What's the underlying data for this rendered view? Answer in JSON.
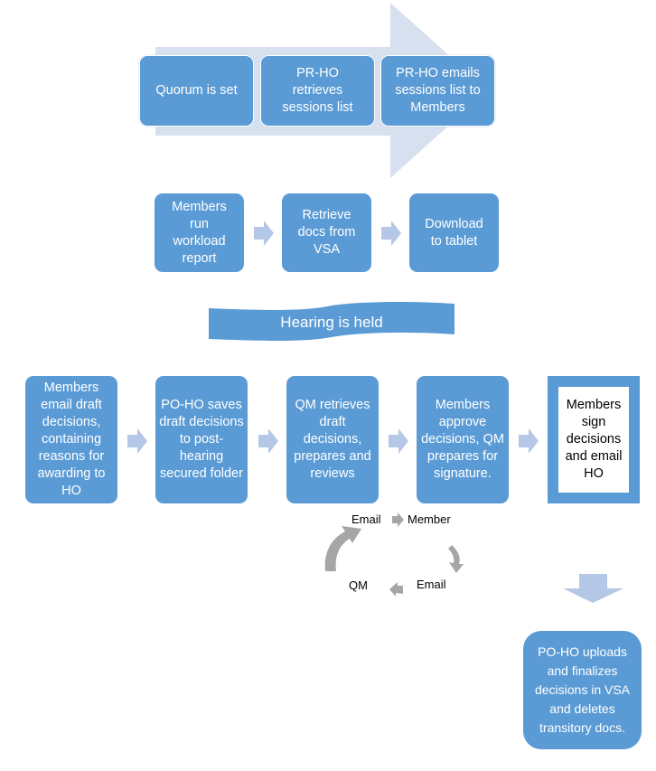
{
  "colors": {
    "box_fill": "#5b9bd5",
    "arrow_fill": "#b4c7e7",
    "big_arrow_fill": "#d6e0ee",
    "cycle_arrow_fill": "#a6a6a6"
  },
  "stage1": {
    "steps": [
      {
        "label": "Quorum is set"
      },
      {
        "label": "PR-HO retrieves sessions list"
      },
      {
        "label": "PR-HO emails sessions list to Members"
      }
    ]
  },
  "stage2": {
    "steps": [
      {
        "label": "Members run workload report"
      },
      {
        "label": "Retrieve docs from VSA"
      },
      {
        "label": "Download to tablet"
      }
    ]
  },
  "banner": {
    "label": "Hearing is held"
  },
  "stage3": {
    "steps": [
      {
        "label": "Members email draft decisions, containing reasons for awarding to HO"
      },
      {
        "label": "PO-HO saves draft decisions to post-hearing secured folder"
      },
      {
        "label": "QM retrieves draft decisions, prepares and reviews"
      },
      {
        "label": "Members approve decisions, QM prepares for signature."
      },
      {
        "label": "Members sign decisions and email HO"
      }
    ]
  },
  "cycle": {
    "nodes": [
      {
        "label": "Email"
      },
      {
        "label": "Member"
      },
      {
        "label": "Email"
      },
      {
        "label": "QM"
      }
    ]
  },
  "final": {
    "label": "PO-HO uploads and finalizes decisions in VSA and deletes transitory docs."
  }
}
